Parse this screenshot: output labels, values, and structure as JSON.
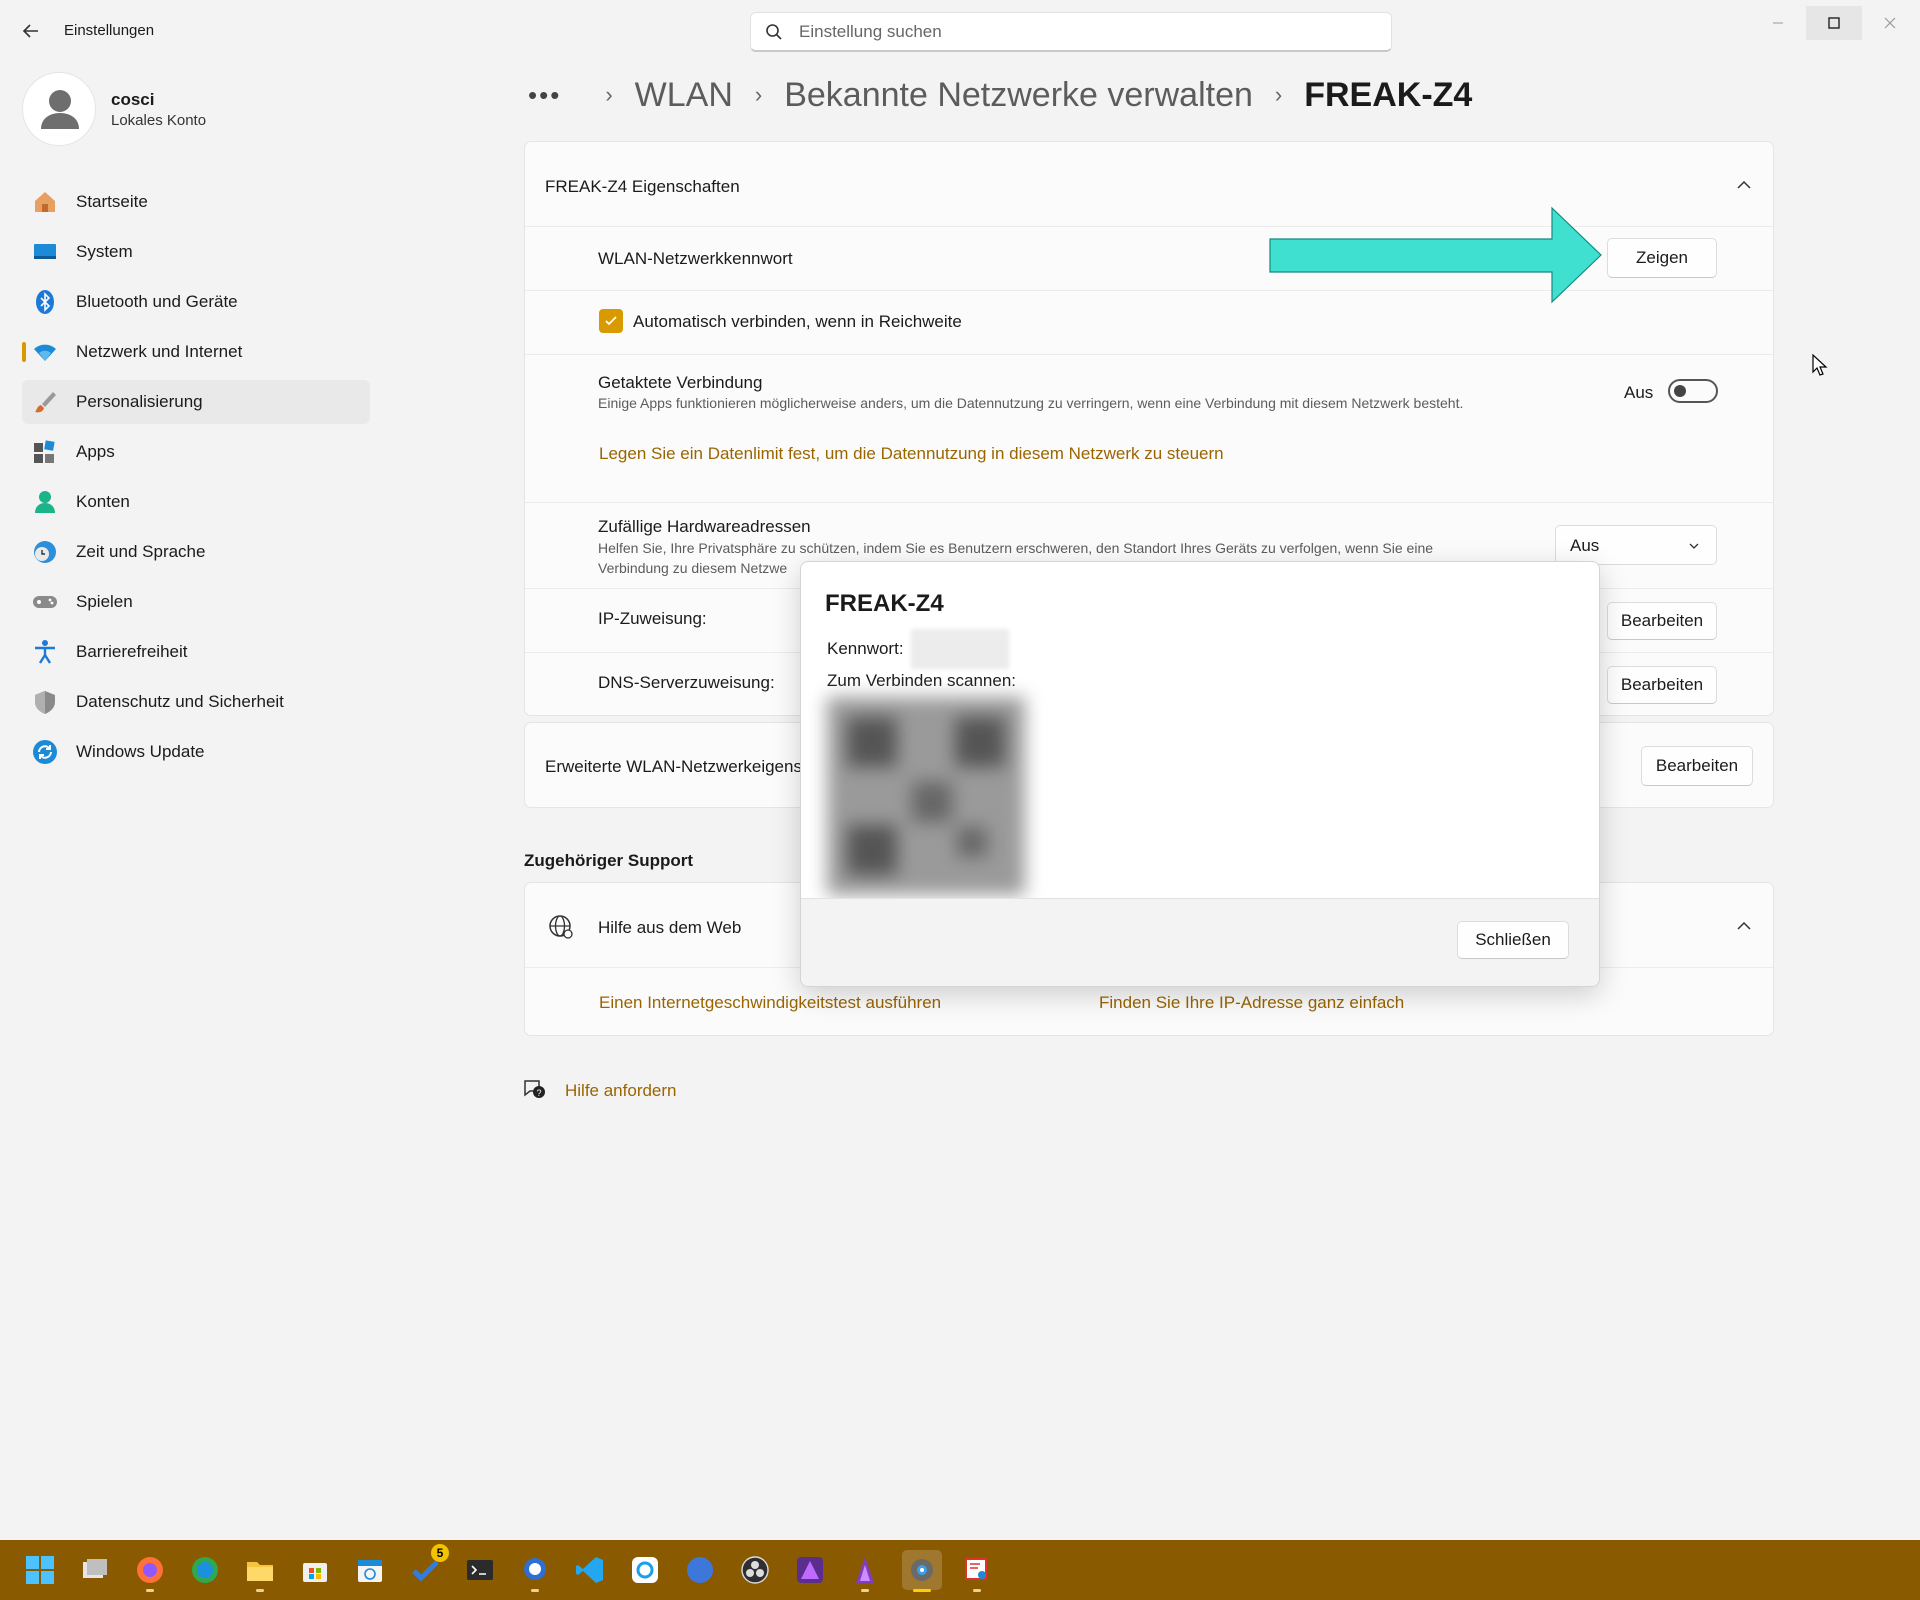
{
  "window": {
    "title": "Einstellungen",
    "search_placeholder": "Einstellung suchen",
    "controls": [
      "minimize-icon",
      "maximize-icon",
      "close-icon"
    ]
  },
  "profile": {
    "name": "cosci",
    "account_type": "Lokales Konto"
  },
  "sidebar": {
    "items": [
      {
        "label": "Startseite",
        "icon": "home-icon"
      },
      {
        "label": "System",
        "icon": "system-icon"
      },
      {
        "label": "Bluetooth und Geräte",
        "icon": "bluetooth-icon"
      },
      {
        "label": "Netzwerk und Internet",
        "icon": "wifi-icon",
        "selected": true
      },
      {
        "label": "Personalisierung",
        "icon": "brush-icon",
        "hover": true
      },
      {
        "label": "Apps",
        "icon": "apps-icon"
      },
      {
        "label": "Konten",
        "icon": "account-icon"
      },
      {
        "label": "Zeit und Sprache",
        "icon": "clock-globe-icon"
      },
      {
        "label": "Spielen",
        "icon": "gamepad-icon"
      },
      {
        "label": "Barrierefreiheit",
        "icon": "accessibility-icon"
      },
      {
        "label": "Datenschutz und Sicherheit",
        "icon": "shield-icon"
      },
      {
        "label": "Windows Update",
        "icon": "update-icon"
      }
    ]
  },
  "breadcrumb": {
    "more": "•••",
    "items": [
      "WLAN",
      "Bekannte Netzwerke verwalten"
    ],
    "current": "FREAK-Z4"
  },
  "properties": {
    "header": "FREAK-Z4 Eigenschaften",
    "password_label": "WLAN-Netzwerkkennwort",
    "show_button": "Zeigen",
    "auto_connect_label": "Automatisch verbinden, wenn in Reichweite",
    "auto_connect_checked": true,
    "metered_title": "Getaktete Verbindung",
    "metered_desc": "Einige Apps funktionieren möglicherweise anders, um die Datennutzung zu verringern, wenn eine Verbindung mit diesem Netzwerk besteht.",
    "metered_state": "Aus",
    "metered_on": false,
    "data_limit_link": "Legen Sie ein Datenlimit fest, um die Datennutzung in diesem Netzwerk zu steuern",
    "random_hw_title": "Zufällige Hardwareadressen",
    "random_hw_desc_1": "Helfen Sie, Ihre Privatsphäre zu schützen, indem Sie es Benutzern erschweren, den Standort Ihres Geräts zu verfolgen, wenn Sie eine",
    "random_hw_desc_2": "Verbindung zu diesem Netzwe",
    "random_hw_value": "Aus",
    "ip_label": "IP-Zuweisung:",
    "ip_button": "Bearbeiten",
    "dns_label": "DNS-Serverzuweisung:",
    "dns_button": "Bearbeiten"
  },
  "advanced": {
    "label": "Erweiterte WLAN-Netzwerkeigens",
    "button": "Bearbeiten"
  },
  "support": {
    "section_title": "Zugehöriger Support",
    "help_web": "Hilfe aus dem Web",
    "link_speedtest": "Einen Internetgeschwindigkeitstest ausführen",
    "link_ip": "Finden Sie Ihre IP-Adresse ganz einfach",
    "get_help": "Hilfe anfordern"
  },
  "dialog": {
    "title": "FREAK-Z4",
    "password_label": "Kennwort:",
    "password_value": "••••••••",
    "scan_label": "Zum Verbinden scannen:",
    "close_button": "Schließen"
  },
  "colors": {
    "accent": "#d89a00",
    "link": "#9a6500",
    "annotation_arrow": "#40e0d0",
    "taskbar": "#8a5a00"
  },
  "taskbar": {
    "items": [
      {
        "icon": "start-icon"
      },
      {
        "icon": "task-view-icon"
      },
      {
        "icon": "firefox-icon"
      },
      {
        "icon": "edge-icon"
      },
      {
        "icon": "file-explorer-icon"
      },
      {
        "icon": "store-icon"
      },
      {
        "icon": "calendar-icon"
      },
      {
        "icon": "todo-icon",
        "badge": "5"
      },
      {
        "icon": "terminal-icon"
      },
      {
        "icon": "chat-icon"
      },
      {
        "icon": "vscode-icon"
      },
      {
        "icon": "sync-icon"
      },
      {
        "icon": "canva-icon"
      },
      {
        "icon": "obs-icon"
      },
      {
        "icon": "affinity-photo-icon"
      },
      {
        "icon": "affinity-designer-icon"
      },
      {
        "icon": "settings-icon",
        "active": true
      },
      {
        "icon": "snipping-tool-icon"
      }
    ]
  }
}
